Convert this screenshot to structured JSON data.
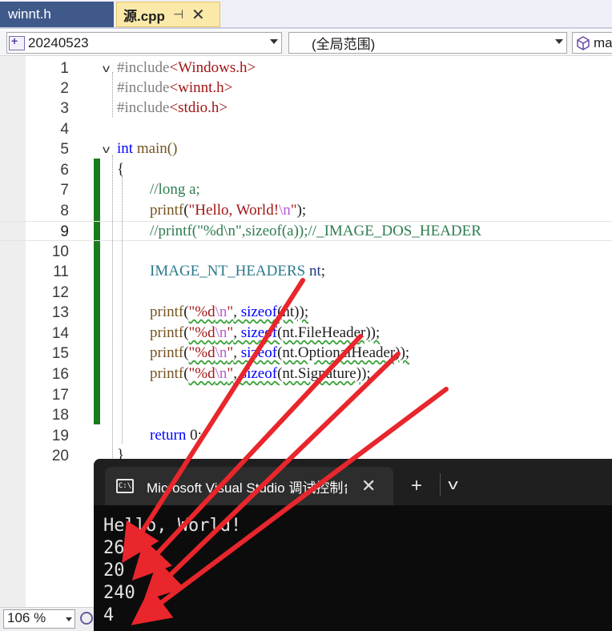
{
  "tabs": [
    {
      "label": "winnt.h",
      "active": false
    },
    {
      "label": "源.cpp",
      "active": true,
      "pin_icon": "pin-icon",
      "close_icon": "close-icon"
    }
  ],
  "navbar": {
    "project": "20240523",
    "scope": "(全局范围)",
    "member": "ma"
  },
  "editor": {
    "line_numbers": [
      "1",
      "2",
      "3",
      "4",
      "5",
      "6",
      "7",
      "8",
      "9",
      "10",
      "11",
      "12",
      "13",
      "14",
      "15",
      "16",
      "17",
      "18",
      "19",
      "20"
    ],
    "current_line": "9",
    "lines": {
      "l1": {
        "directive": "#include",
        "header": "<Windows.h>"
      },
      "l2": {
        "directive": "#include",
        "header": "<winnt.h>"
      },
      "l3": {
        "directive": "#include",
        "header": "<stdio.h>"
      },
      "l5": {
        "kw": "int",
        "rest": " main()"
      },
      "l6": {
        "text": "{"
      },
      "l7": {
        "comment": "//long a;"
      },
      "l8": {
        "fn": "printf",
        "open": "(",
        "str1": "\"Hello, World!",
        "esc": "\\n",
        "str2": "\"",
        "close": ");"
      },
      "l9": {
        "comment": "//printf(\"%d\\n\",sizeof(a));//_IMAGE_DOS_HEADER"
      },
      "l11": {
        "type": "IMAGE_NT_HEADERS",
        "var": " nt",
        "end": ";"
      },
      "l13": {
        "fn": "printf",
        "open": "(",
        "str1": "\"%d",
        "esc": "\\n",
        "str2": "\"",
        "comma": ", ",
        "kw": "sizeof",
        "args": "(nt));"
      },
      "l14": {
        "fn": "printf",
        "open": "(",
        "str1": "\"%d",
        "esc": "\\n",
        "str2": "\"",
        "comma": ", ",
        "kw": "sizeof",
        "args": "(nt.FileHeader));"
      },
      "l15": {
        "fn": "printf",
        "open": "(",
        "str1": "\"%d",
        "esc": "\\n",
        "str2": "\"",
        "comma": ", ",
        "kw": "sizeof",
        "args": "(nt.OptionalHeader));"
      },
      "l16": {
        "fn": "printf",
        "open": "(",
        "str1": "\"%d",
        "esc": "\\n",
        "str2": "\"",
        "comma": ", ",
        "kw": "sizeof",
        "args": "(nt.Signature));"
      },
      "l19": {
        "kw": "return",
        "rest": " 0;"
      },
      "l20": {
        "text": "}"
      }
    }
  },
  "terminal": {
    "tab_title": "Microsoft Visual Studio 调试控制台",
    "plus_label": "+",
    "output": [
      "Hello, World!",
      "264",
      "20",
      "240",
      "4"
    ]
  },
  "statusbar": {
    "zoom": "106 %"
  },
  "colors": {
    "keyword": "#0000ff",
    "string": "#a31515",
    "comment": "#2e7d4f",
    "type": "#2b7a8c",
    "change_bar": "#1c7a1c",
    "annotation_arrow": "#e8262b",
    "active_tab": "#fbe9a9",
    "inactive_tab": "#3f5a8a"
  }
}
